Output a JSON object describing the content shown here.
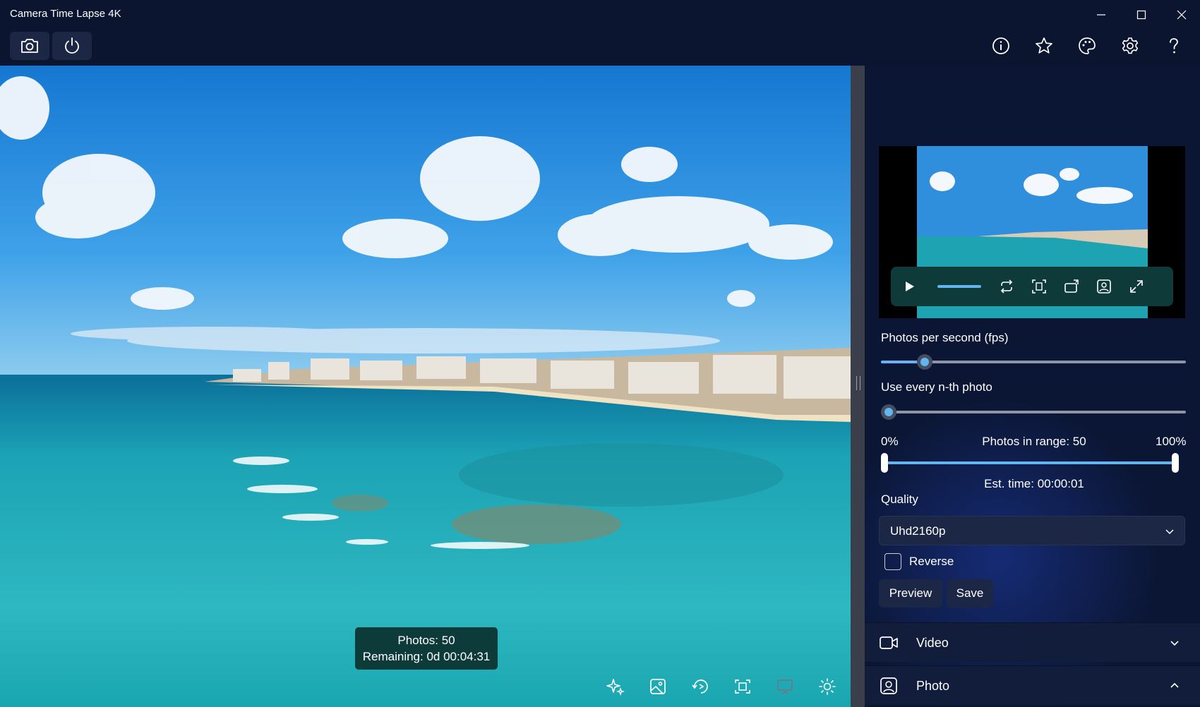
{
  "window": {
    "title": "Camera Time Lapse 4K"
  },
  "toolbar": {
    "left_buttons": [
      "camera-icon",
      "power-icon"
    ],
    "right_icons": [
      "info-icon",
      "star-icon",
      "palette-icon",
      "gear-icon",
      "help-icon"
    ]
  },
  "colors": {
    "background": "#0b1530",
    "accent": "#63b4f1",
    "overlay": "#0d3b3a"
  },
  "preview": {
    "controls": [
      "play-icon",
      "progress-bar",
      "repeat-icon",
      "fit-icon",
      "rotate-icon",
      "photo-icon",
      "fullscreen-icon"
    ]
  },
  "settings": {
    "fps_label": "Photos per second (fps)",
    "fps_level": 0.15,
    "nth_label": "Use every n-th photo",
    "nth_level": 0.0,
    "range_min_label": "0%",
    "range_max_label": "100%",
    "range_center_label": "Photos in range: 50",
    "est_time": "Est. time: 00:00:01",
    "quality_label": "Quality",
    "quality_value": "Uhd2160p",
    "reverse_label": "Reverse",
    "reverse_checked": false,
    "preview_button": "Preview",
    "save_button": "Save"
  },
  "expanders": [
    {
      "label": "Video",
      "icon": "video-camera-icon",
      "expanded": false
    },
    {
      "label": "Photo",
      "icon": "photo-icon",
      "expanded": true
    }
  ],
  "status": {
    "photos": "Photos: 50",
    "remaining": "Remaining: 0d 00:04:31"
  },
  "bottom_tools": [
    "sparkle-icon",
    "image-icon",
    "rotate-icon",
    "fit-icon",
    "monitor-icon",
    "brightness-icon"
  ]
}
